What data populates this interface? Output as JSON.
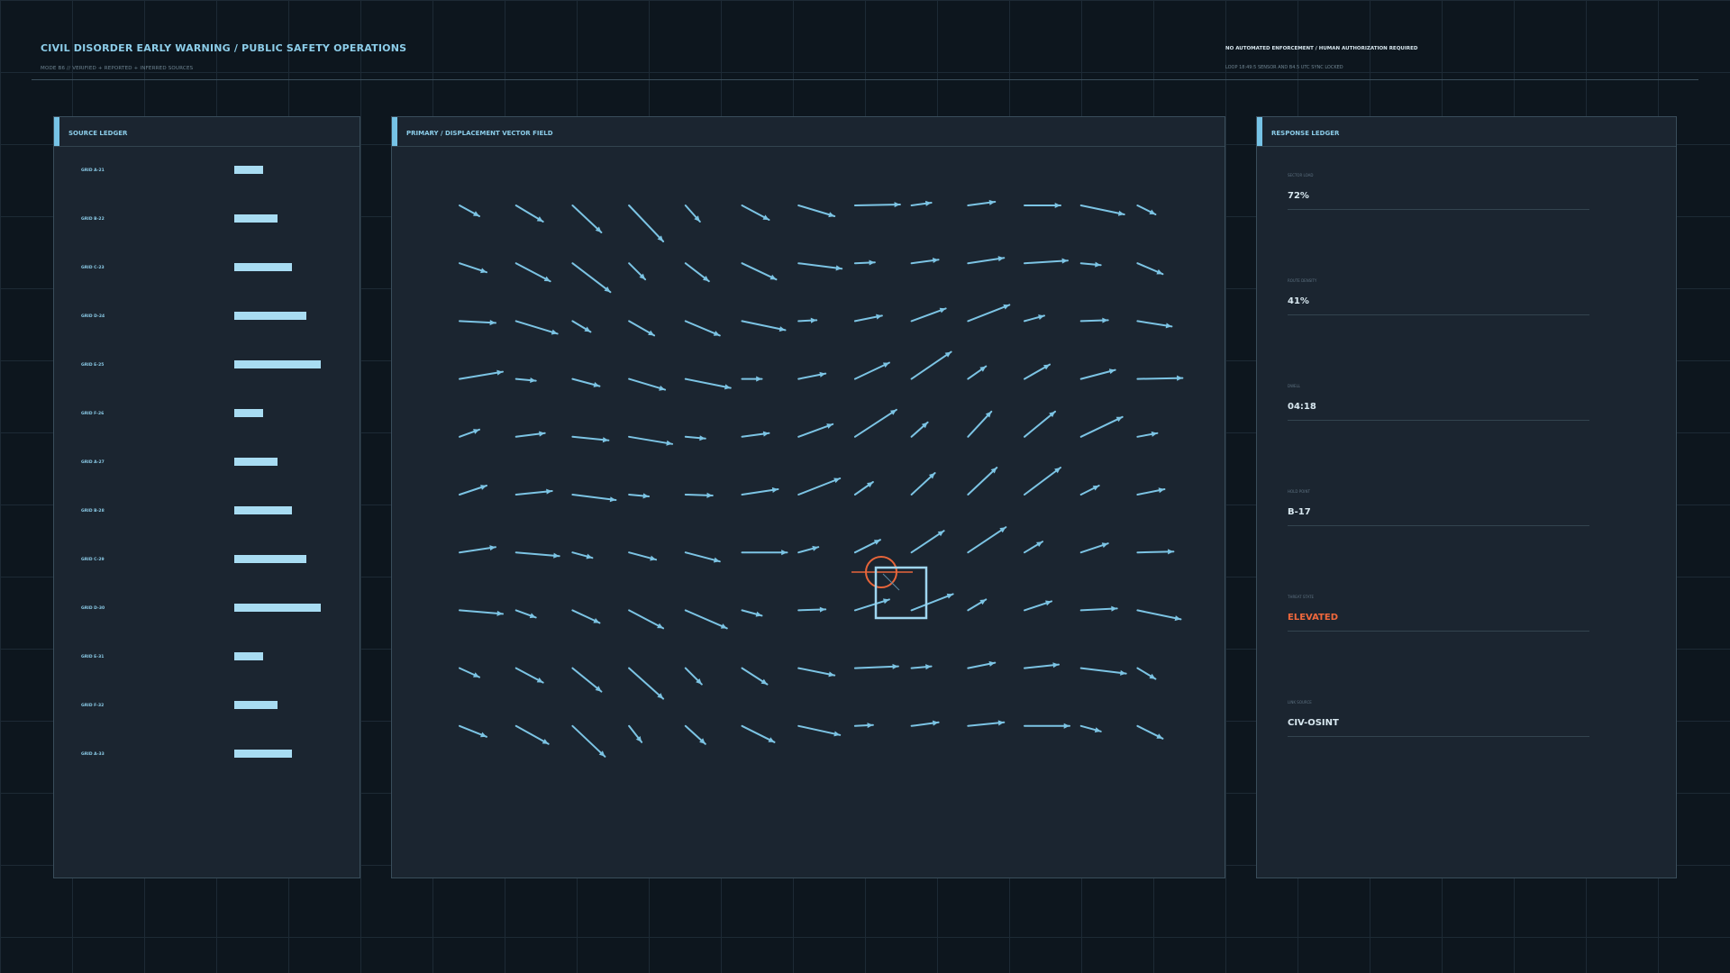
{
  "header": {
    "title": "CIVIL DISORDER EARLY WARNING / PUBLIC SAFETY OPERATIONS",
    "subtitle": "MODE B6  //  VERIFIED + REPORTED + INFERRED SOURCES",
    "notice": "NO AUTOMATED ENFORCEMENT / HUMAN AUTHORIZATION REQUIRED",
    "status": "LOOP 18:49:5  SENSOR AND B4.5  UTC SYNC LOCKED"
  },
  "source_ledger": {
    "title": "SOURCE LEDGER",
    "rows": [
      {
        "label": "GRID A-21",
        "level": 0.33
      },
      {
        "label": "GRID B-22",
        "level": 0.5
      },
      {
        "label": "GRID C-23",
        "level": 0.67
      },
      {
        "label": "GRID D-24",
        "level": 0.83
      },
      {
        "label": "GRID E-25",
        "level": 1.0
      },
      {
        "label": "GRID F-26",
        "level": 0.33
      },
      {
        "label": "GRID A-27",
        "level": 0.5
      },
      {
        "label": "GRID B-28",
        "level": 0.67
      },
      {
        "label": "GRID C-29",
        "level": 0.83
      },
      {
        "label": "GRID D-30",
        "level": 1.0
      },
      {
        "label": "GRID E-31",
        "level": 0.33
      },
      {
        "label": "GRID F-32",
        "level": 0.5
      },
      {
        "label": "GRID A-33",
        "level": 0.67
      }
    ]
  },
  "vector_field": {
    "title": "PRIMARY / DISPLACEMENT VECTOR FIELD",
    "arrow_color": "#7cc4e4",
    "marker_color": "#e8653a",
    "focus_box_color": "#9fd6f0",
    "vectors": [
      [
        [
          22,
          12
        ],
        [
          30,
          18
        ],
        [
          32,
          30
        ],
        [
          38,
          40
        ],
        [
          16,
          18
        ],
        [
          30,
          16
        ],
        [
          40,
          12
        ],
        [
          50,
          -1
        ],
        [
          22,
          -3
        ],
        [
          30,
          -4
        ],
        [
          40,
          0
        ],
        [
          48,
          10
        ],
        [
          20,
          10
        ]
      ],
      [
        [
          30,
          10
        ],
        [
          38,
          20
        ],
        [
          42,
          32
        ],
        [
          18,
          18
        ],
        [
          26,
          20
        ],
        [
          38,
          18
        ],
        [
          48,
          6
        ],
        [
          22,
          -1
        ],
        [
          30,
          -4
        ],
        [
          40,
          -6
        ],
        [
          48,
          -3
        ],
        [
          22,
          2
        ],
        [
          28,
          12
        ]
      ],
      [
        [
          40,
          2
        ],
        [
          46,
          14
        ],
        [
          20,
          12
        ],
        [
          28,
          16
        ],
        [
          38,
          16
        ],
        [
          48,
          10
        ],
        [
          20,
          -1
        ],
        [
          30,
          -6
        ],
        [
          38,
          -14
        ],
        [
          46,
          -18
        ],
        [
          22,
          -6
        ],
        [
          30,
          -1
        ],
        [
          38,
          6
        ]
      ],
      [
        [
          48,
          -8
        ],
        [
          22,
          2
        ],
        [
          30,
          8
        ],
        [
          40,
          12
        ],
        [
          50,
          10
        ],
        [
          22,
          0
        ],
        [
          30,
          -6
        ],
        [
          38,
          -18
        ],
        [
          44,
          -30
        ],
        [
          20,
          -14
        ],
        [
          28,
          -16
        ],
        [
          38,
          -10
        ],
        [
          50,
          -1
        ]
      ],
      [
        [
          22,
          -8
        ],
        [
          32,
          -4
        ],
        [
          40,
          4
        ],
        [
          48,
          8
        ],
        [
          22,
          2
        ],
        [
          30,
          -4
        ],
        [
          38,
          -14
        ],
        [
          46,
          -30
        ],
        [
          18,
          -16
        ],
        [
          26,
          -28
        ],
        [
          34,
          -28
        ],
        [
          46,
          -22
        ],
        [
          22,
          -4
        ]
      ],
      [
        [
          30,
          -10
        ],
        [
          40,
          -4
        ],
        [
          48,
          6
        ],
        [
          22,
          2
        ],
        [
          30,
          1
        ],
        [
          40,
          -6
        ],
        [
          46,
          -18
        ],
        [
          20,
          -14
        ],
        [
          26,
          -24
        ],
        [
          32,
          -30
        ],
        [
          40,
          -30
        ],
        [
          20,
          -10
        ],
        [
          30,
          -6
        ]
      ],
      [
        [
          40,
          -6
        ],
        [
          48,
          4
        ],
        [
          22,
          6
        ],
        [
          30,
          8
        ],
        [
          38,
          10
        ],
        [
          50,
          0
        ],
        [
          22,
          -6
        ],
        [
          28,
          -14
        ],
        [
          36,
          -24
        ],
        [
          42,
          -28
        ],
        [
          20,
          -12
        ],
        [
          30,
          -10
        ],
        [
          40,
          -1
        ]
      ],
      [
        [
          48,
          4
        ],
        [
          22,
          8
        ],
        [
          30,
          14
        ],
        [
          38,
          20
        ],
        [
          46,
          20
        ],
        [
          22,
          6
        ],
        [
          30,
          -1
        ],
        [
          38,
          -12
        ],
        [
          46,
          -18
        ],
        [
          20,
          -12
        ],
        [
          30,
          -10
        ],
        [
          40,
          -2
        ],
        [
          48,
          10
        ]
      ],
      [
        [
          22,
          10
        ],
        [
          30,
          16
        ],
        [
          32,
          26
        ],
        [
          38,
          34
        ],
        [
          18,
          18
        ],
        [
          28,
          18
        ],
        [
          40,
          8
        ],
        [
          48,
          -2
        ],
        [
          22,
          -2
        ],
        [
          30,
          -6
        ],
        [
          38,
          -4
        ],
        [
          50,
          6
        ],
        [
          20,
          12
        ]
      ],
      [
        [
          30,
          12
        ],
        [
          36,
          20
        ],
        [
          36,
          34
        ],
        [
          14,
          18
        ],
        [
          22,
          20
        ],
        [
          36,
          18
        ],
        [
          46,
          10
        ],
        [
          20,
          -1
        ],
        [
          30,
          -4
        ],
        [
          40,
          -4
        ],
        [
          50,
          0
        ],
        [
          22,
          6
        ],
        [
          28,
          14
        ]
      ]
    ]
  },
  "response_ledger": {
    "title": "RESPONSE LEDGER",
    "items": [
      {
        "label": "SECTOR LOAD",
        "value": "72%",
        "alert": false
      },
      {
        "label": "ROUTE DENSITY",
        "value": "41%",
        "alert": false
      },
      {
        "label": "DWELL",
        "value": "04:18",
        "alert": false
      },
      {
        "label": "HOLD POINT",
        "value": "B-17",
        "alert": false
      },
      {
        "label": "THREAT STATE",
        "value": "ELEVATED",
        "alert": true
      },
      {
        "label": "LINK SOURCE",
        "value": "CIV-OSINT",
        "alert": false
      }
    ]
  }
}
